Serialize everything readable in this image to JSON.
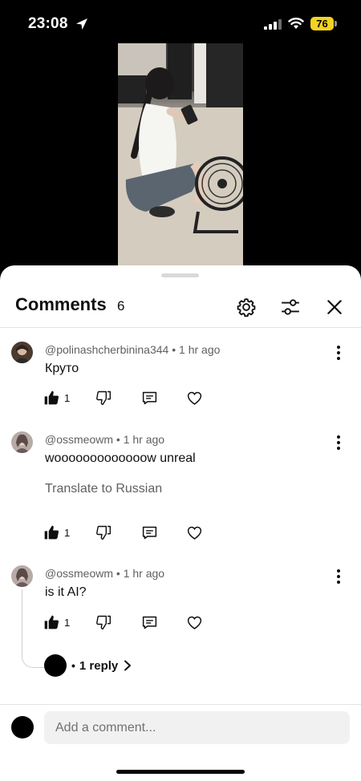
{
  "status_bar": {
    "time": "23:08",
    "battery": "76",
    "battery_color": "#f4d21f"
  },
  "sheet": {
    "title": "Comments",
    "count": "6",
    "header_icons": [
      "gear-icon",
      "sliders-icon",
      "close-icon"
    ]
  },
  "comments": [
    {
      "author": "@polinashcherbinina344",
      "time": "1 hr ago",
      "text": "Круто",
      "likes": "1"
    },
    {
      "author": "@ossmeowm",
      "time": "1 hr ago",
      "text": "wooooooooooooow unreal",
      "translate": "Translate to Russian",
      "likes": "1"
    },
    {
      "author": "@ossmeowm",
      "time": "1 hr ago",
      "text": "is it AI?",
      "likes": "1",
      "replies": "1 reply"
    }
  ],
  "composer": {
    "placeholder": "Add a comment..."
  }
}
